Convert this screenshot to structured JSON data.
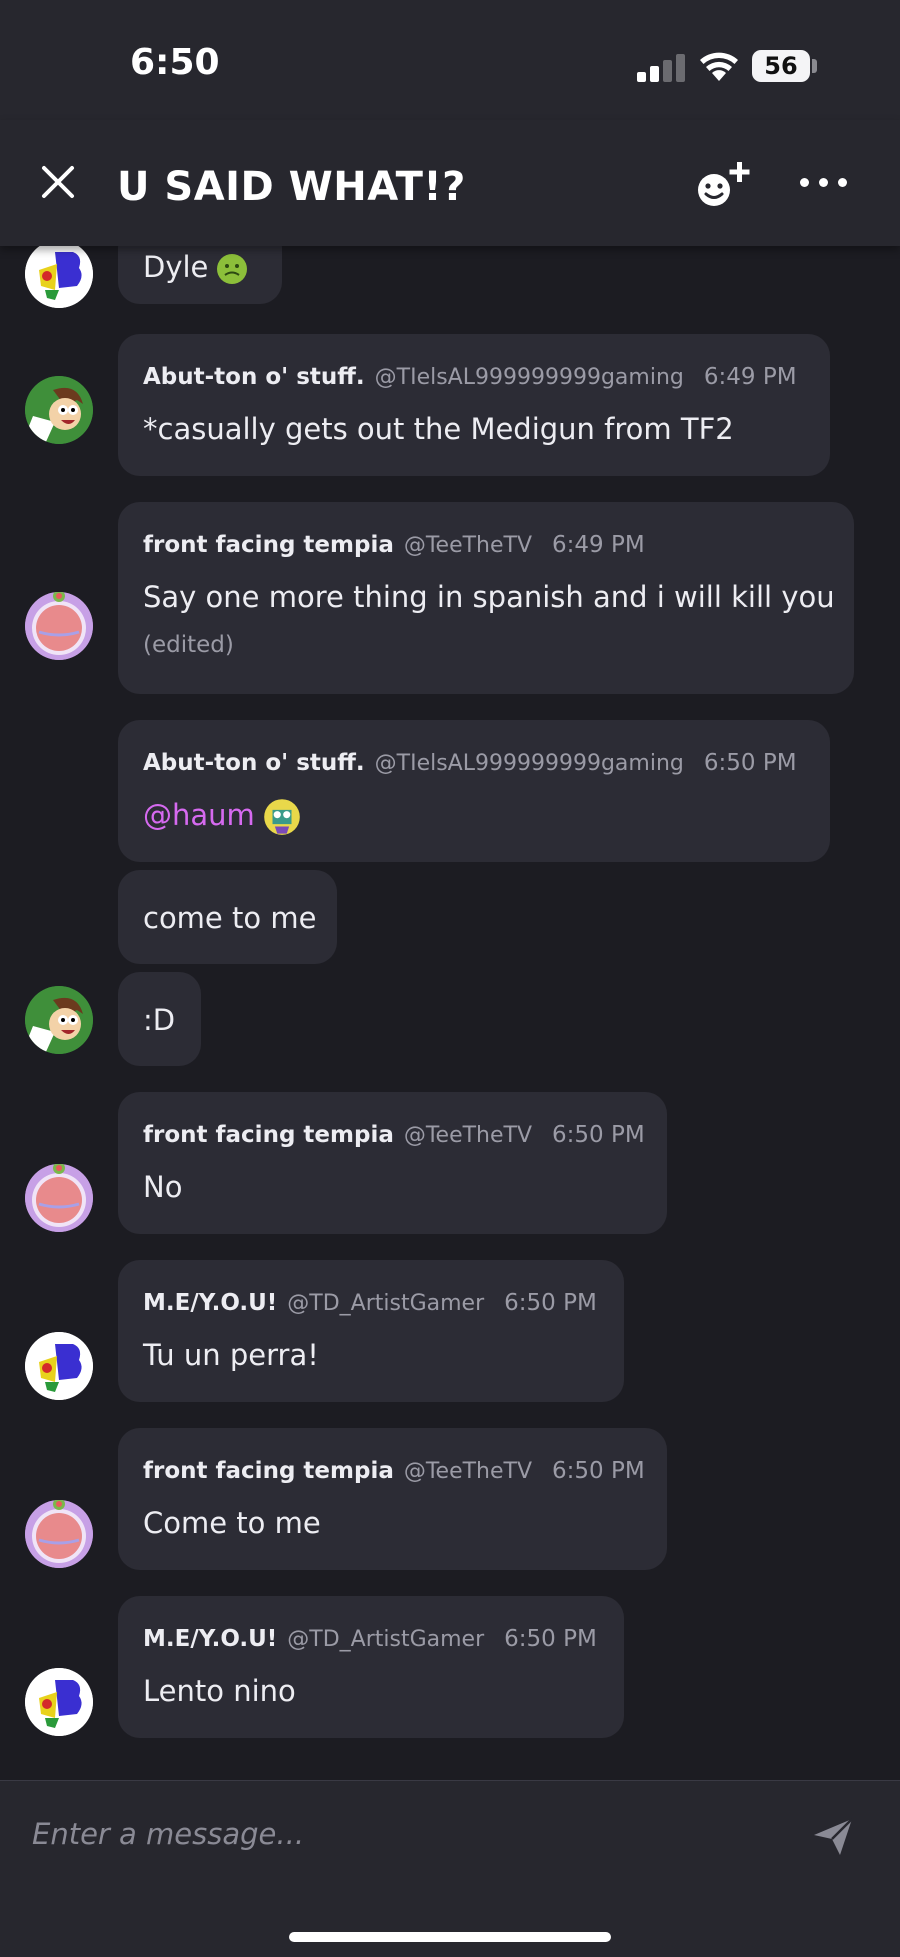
{
  "status_bar": {
    "time": "6:50",
    "battery": "56"
  },
  "header": {
    "title": "U SAID WHAT!?"
  },
  "messages": [
    {
      "body": "Dyle",
      "emoji": "nauseated-face-emoji"
    },
    {
      "name": "Abut-ton o' stuff.",
      "handle": "@TIelsAL999999999gaming",
      "time": "6:49 PM",
      "body": "*casually gets out the Medigun from TF2"
    },
    {
      "name": "front facing tempia",
      "handle": "@TeeTheTV",
      "time": "6:49 PM",
      "body": "Say one more thing in spanish and i will kill you",
      "edited": "(edited)"
    },
    {
      "name": "Abut-ton o' stuff.",
      "handle": "@TIelsAL999999999gaming",
      "time": "6:50 PM",
      "mention": "@haum"
    },
    {
      "body": "come to me"
    },
    {
      "body": ":D"
    },
    {
      "name": "front facing tempia",
      "handle": "@TeeTheTV",
      "time": "6:50 PM",
      "body": "No"
    },
    {
      "name": "M.E/Y.O.U!",
      "handle": "@TD_ArtistGamer",
      "time": "6:50 PM",
      "body": "Tu un perra!"
    },
    {
      "name": "front facing tempia",
      "handle": "@TeeTheTV",
      "time": "6:50 PM",
      "body": "Come to me"
    },
    {
      "name": "M.E/Y.O.U!",
      "handle": "@TD_ArtistGamer",
      "time": "6:50 PM",
      "body": "Lento nino"
    }
  ],
  "composer": {
    "placeholder": "Enter a message..."
  },
  "colors": {
    "background": "#1c1c22",
    "bubble": "#2c2c35",
    "header": "#27272e",
    "mention": "#d66af0",
    "muted": "#9b9ba6"
  }
}
